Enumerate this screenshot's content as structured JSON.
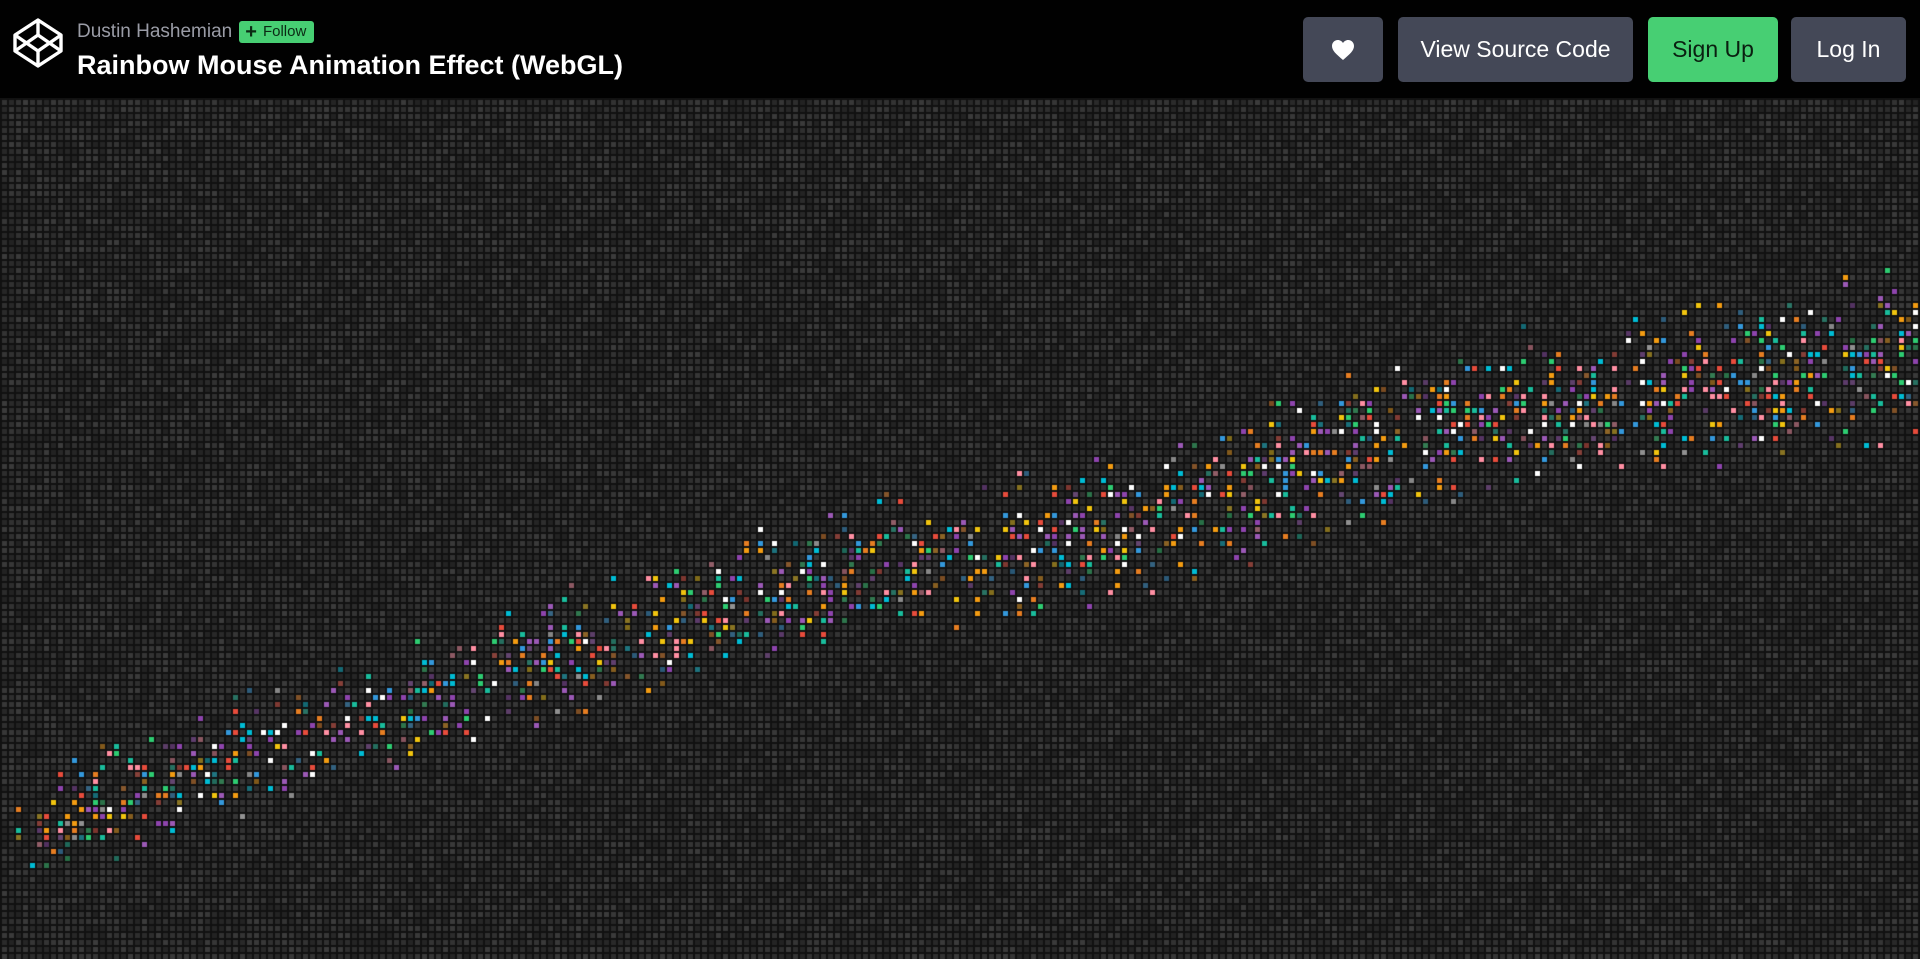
{
  "header": {
    "author": "Dustin Hashemian",
    "follow_label": "Follow",
    "title": "Rainbow Mouse Animation Effect (WebGL)"
  },
  "buttons": {
    "heart_icon": "heart-icon",
    "view_source": "View Source Code",
    "sign_up": "Sign Up",
    "log_in": "Log In"
  },
  "colors": {
    "follow_green": "#47cf73",
    "button_gray": "#444857",
    "signup_green": "#47cf73",
    "pixel_palette": [
      "#2ecc71",
      "#f39c12",
      "#e74c3c",
      "#9b59b6",
      "#3498db",
      "#1abc9c",
      "#f1c40f",
      "#e67e22",
      "#ffffff",
      "#ff8fa3",
      "#00bcd4",
      "#8e44ad"
    ]
  }
}
